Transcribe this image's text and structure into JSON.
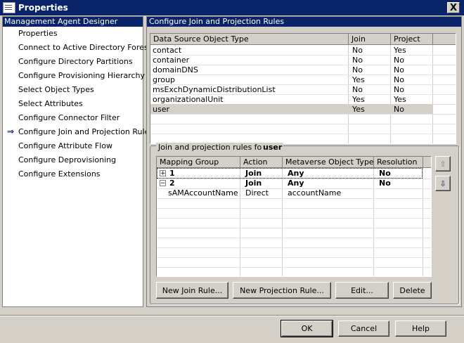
{
  "window": {
    "title": "Properties",
    "close_label": "X"
  },
  "sidebar": {
    "header": "Management Agent Designer",
    "items": [
      {
        "label": "Properties"
      },
      {
        "label": "Connect to Active Directory Forest"
      },
      {
        "label": "Configure Directory Partitions"
      },
      {
        "label": "Configure Provisioning Hierarchy"
      },
      {
        "label": "Select Object Types"
      },
      {
        "label": "Select Attributes"
      },
      {
        "label": "Configure Connector Filter"
      },
      {
        "label": "Configure Join and Projection Rules",
        "selected": true
      },
      {
        "label": "Configure Attribute Flow"
      },
      {
        "label": "Configure Deprovisioning"
      },
      {
        "label": "Configure Extensions"
      }
    ]
  },
  "main": {
    "header": "Configure Join and Projection Rules",
    "datasource_table": {
      "columns": [
        "Data Source Object Type",
        "Join",
        "Project"
      ],
      "rows": [
        [
          "contact",
          "No",
          "Yes"
        ],
        [
          "container",
          "No",
          "No"
        ],
        [
          "domainDNS",
          "No",
          "No"
        ],
        [
          "group",
          "Yes",
          "No"
        ],
        [
          "msExchDynamicDistributionList",
          "No",
          "No"
        ],
        [
          "organizationalUnit",
          "Yes",
          "Yes"
        ],
        [
          "user",
          "Yes",
          "No"
        ]
      ],
      "selected_row": 6
    },
    "rules": {
      "label": "Join and projection rules for:",
      "object_type": "user",
      "columns": [
        "Mapping Group",
        "Action",
        "Metaverse Object Type",
        "Resolution"
      ],
      "groups": [
        {
          "id": "1",
          "action": "Join",
          "mv_type": "Any",
          "resolution": "No",
          "expanded": false
        },
        {
          "id": "2",
          "action": "Join",
          "mv_type": "Any",
          "resolution": "No",
          "expanded": true
        }
      ],
      "detail_rows": [
        {
          "source": "sAMAccountName",
          "method": "Direct",
          "target": "accountName"
        }
      ],
      "buttons": {
        "new_join": "New Join Rule...",
        "new_projection": "New Projection Rule...",
        "edit": "Edit...",
        "delete": "Delete"
      }
    }
  },
  "footer": {
    "ok": "OK",
    "cancel": "Cancel",
    "help": "Help"
  }
}
